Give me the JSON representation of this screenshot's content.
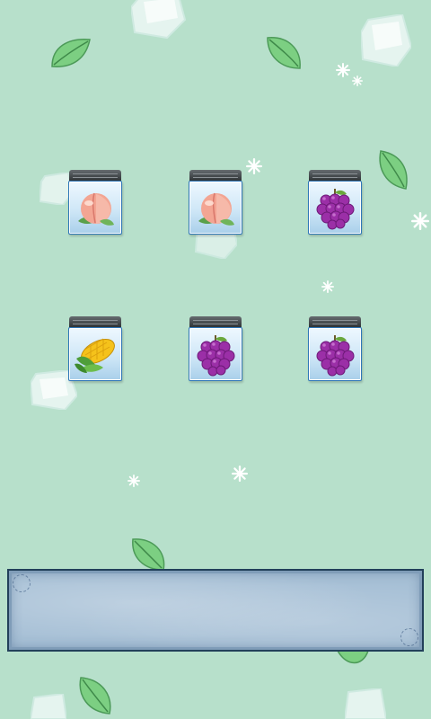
{
  "board": {
    "tiles": [
      {
        "fruit": "peach",
        "icon": "peach-icon"
      },
      {
        "fruit": "peach",
        "icon": "peach-icon"
      },
      {
        "fruit": "grape",
        "icon": "grape-icon"
      },
      {
        "fruit": "corn",
        "icon": "corn-icon"
      },
      {
        "fruit": "grape",
        "icon": "grape-icon"
      },
      {
        "fruit": "grape",
        "icon": "grape-icon"
      }
    ]
  },
  "tray": {
    "slots_filled": 0
  },
  "colors": {
    "background": "#b7e0cb",
    "tile_border": "#2f77b8",
    "tray_border": "#22405a"
  }
}
